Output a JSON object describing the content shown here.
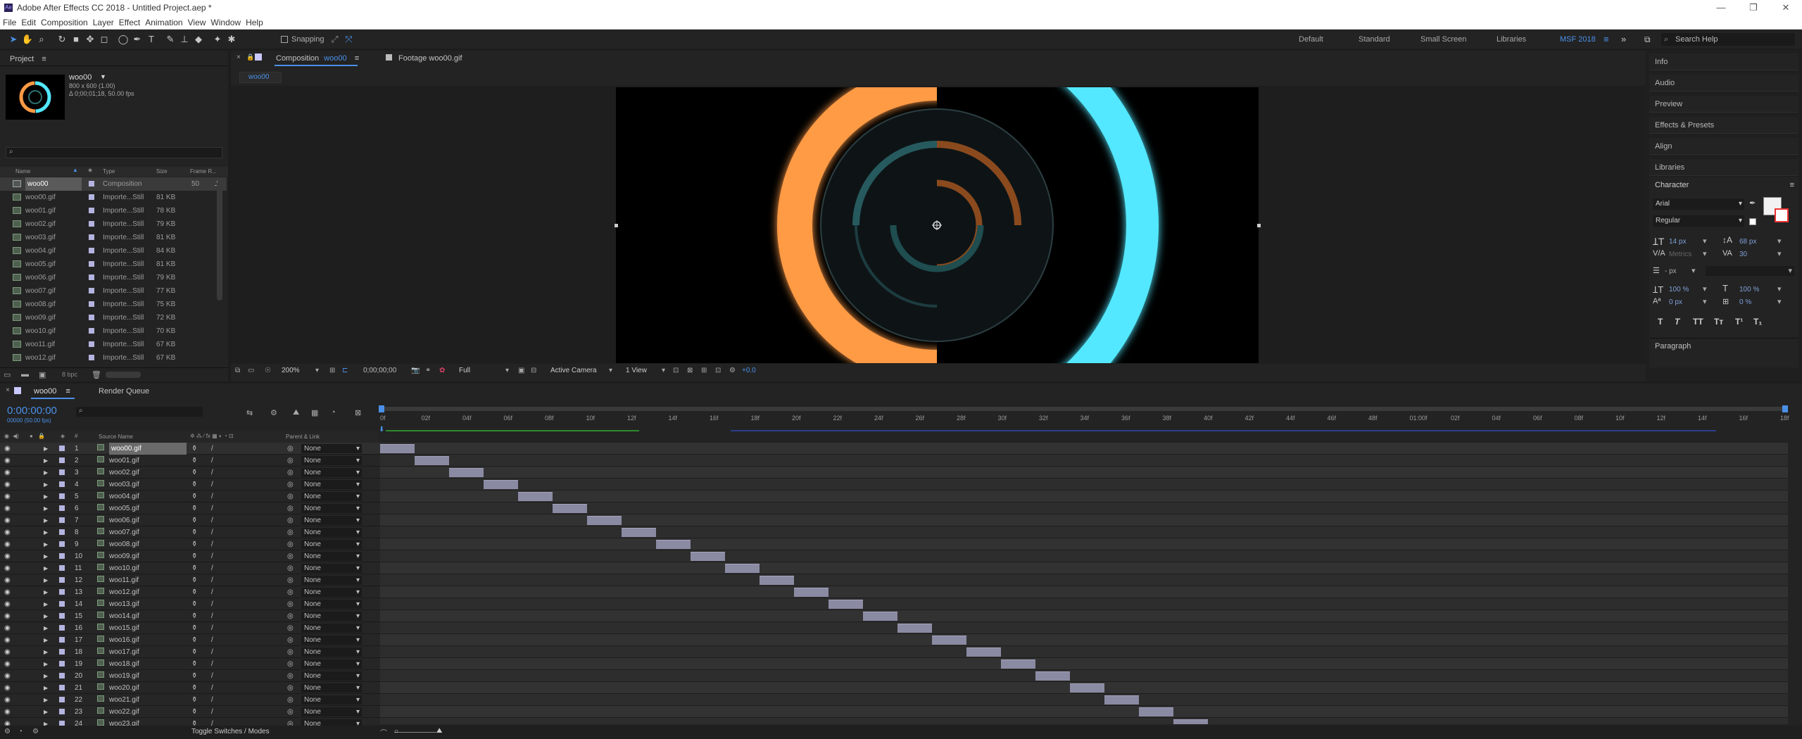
{
  "window": {
    "title": "Adobe After Effects CC 2018 - Untitled Project.aep *",
    "controls": [
      "—",
      "❐",
      "✕"
    ]
  },
  "menu": [
    "File",
    "Edit",
    "Composition",
    "Layer",
    "Effect",
    "Animation",
    "View",
    "Window",
    "Help"
  ],
  "toolbar": {
    "snapping_label": "Snapping",
    "workspaces": [
      "Default",
      "Standard",
      "Small Screen",
      "Libraries",
      "MSF 2018"
    ],
    "active_workspace": "MSF 2018",
    "search_placeholder": "Search Help"
  },
  "project": {
    "tab": "Project",
    "preview_name": "woo00",
    "preview_dims": "800 x 600 (1.00)",
    "preview_duration": "Δ 0;00;01;18, 50.00 fps",
    "columns": [
      "Name",
      "Type",
      "Size",
      "Frame R..."
    ],
    "rows": [
      {
        "name": "woo00",
        "type": "Composition",
        "size": "",
        "fr": "50"
      },
      {
        "name": "woo00.gif",
        "type": "Importe...Still",
        "size": "81 KB",
        "fr": ""
      },
      {
        "name": "woo01.gif",
        "type": "Importe...Still",
        "size": "78 KB",
        "fr": ""
      },
      {
        "name": "woo02.gif",
        "type": "Importe...Still",
        "size": "79 KB",
        "fr": ""
      },
      {
        "name": "woo03.gif",
        "type": "Importe...Still",
        "size": "81 KB",
        "fr": ""
      },
      {
        "name": "woo04.gif",
        "type": "Importe...Still",
        "size": "84 KB",
        "fr": ""
      },
      {
        "name": "woo05.gif",
        "type": "Importe...Still",
        "size": "81 KB",
        "fr": ""
      },
      {
        "name": "woo06.gif",
        "type": "Importe...Still",
        "size": "79 KB",
        "fr": ""
      },
      {
        "name": "woo07.gif",
        "type": "Importe...Still",
        "size": "77 KB",
        "fr": ""
      },
      {
        "name": "woo08.gif",
        "type": "Importe...Still",
        "size": "75 KB",
        "fr": ""
      },
      {
        "name": "woo09.gif",
        "type": "Importe...Still",
        "size": "72 KB",
        "fr": ""
      },
      {
        "name": "woo10.gif",
        "type": "Importe...Still",
        "size": "70 KB",
        "fr": ""
      },
      {
        "name": "woo11.gif",
        "type": "Importe...Still",
        "size": "67 KB",
        "fr": ""
      },
      {
        "name": "woo12.gif",
        "type": "Importe...Still",
        "size": "67 KB",
        "fr": ""
      }
    ],
    "bpc": "8 bpc"
  },
  "composition": {
    "tab_comp": "Composition",
    "tab_comp_name": "woo00",
    "tab_footage": "Footage woo00.gif",
    "flow_tab": "woo00",
    "zoom": "200%",
    "timecode": "0;00;00;00",
    "resolution": "Full",
    "camera": "Active Camera",
    "views": "1 View",
    "exposure": "+0.0"
  },
  "right_panel": {
    "items": [
      "Info",
      "Audio",
      "Preview",
      "Effects & Presets",
      "Align",
      "Libraries"
    ],
    "character_title": "Character",
    "font": "Arial",
    "style": "Regular",
    "font_size": "14 px",
    "leading": "68 px",
    "kerning": "Metrics",
    "tracking": "30",
    "stroke": "- px",
    "vscale": "100 %",
    "hscale": "100 %",
    "baseline": "0 px",
    "tsume": "0 %",
    "style_buttons": [
      "T",
      "T",
      "TT",
      "Tт",
      "T¹",
      "T₁"
    ],
    "paragraph_title": "Paragraph"
  },
  "timeline": {
    "tab_comp": "woo00",
    "tab_render": "Render Queue",
    "timecode": "0:00:00:00",
    "sub_timecode": "00000 (50.00 fps)",
    "header_source": "Source Name",
    "header_parent": "Parent & Link",
    "toggle_label": "Toggle Switches / Modes",
    "ticks": [
      "0f",
      "02f",
      "04f",
      "06f",
      "08f",
      "10f",
      "12f",
      "14f",
      "16f",
      "18f",
      "20f",
      "22f",
      "24f",
      "26f",
      "28f",
      "30f",
      "32f",
      "34f",
      "36f",
      "38f",
      "40f",
      "42f",
      "44f",
      "46f",
      "48f",
      "01:00f",
      "02f",
      "04f",
      "06f",
      "08f",
      "10f",
      "12f",
      "14f",
      "16f",
      "18f"
    ],
    "parent_value": "None",
    "layers": [
      "woo00.gif",
      "woo01.gif",
      "woo02.gif",
      "woo03.gif",
      "woo04.gif",
      "woo05.gif",
      "woo06.gif",
      "woo07.gif",
      "woo08.gif",
      "woo09.gif",
      "woo10.gif",
      "woo11.gif",
      "woo12.gif",
      "woo13.gif",
      "woo14.gif",
      "woo15.gif",
      "woo16.gif",
      "woo17.gif",
      "woo18.gif",
      "woo19.gif",
      "woo20.gif",
      "woo21.gif",
      "woo22.gif",
      "woo23.gif"
    ],
    "layer_numbers": [
      "1",
      "2",
      "3",
      "4",
      "5",
      "6",
      "7",
      "8",
      "9",
      "10",
      "11",
      "12",
      "13",
      "14",
      "15",
      "16",
      "17",
      "18",
      "19",
      "20",
      "21",
      "22",
      "23",
      "24"
    ]
  },
  "colors": {
    "accent": "#4a90e8",
    "orange": "#ff9a45",
    "cyan": "#52e8ff",
    "bar": "#8a8aa3"
  }
}
